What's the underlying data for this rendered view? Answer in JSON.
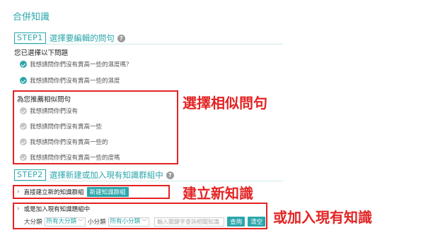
{
  "page_title": "合併知識",
  "step1": {
    "tag": "STEP1",
    "title": "選擇要編輯的問句",
    "selected_label": "您已選擇以下問題",
    "selected_questions": [
      "我想請問你們沒有賣高一些的濕度嗎？",
      "我想請問你們沒有賣高一些的濕度"
    ],
    "recommend_label": "為您推薦相似問句",
    "recommended_questions": [
      "我想請問你們沒有",
      "我想請問你們沒有賣高一些",
      "我想請問你們沒有賣高一些的",
      "我想請問你們沒有賣高一些的度嗎"
    ]
  },
  "step2": {
    "tag": "STEP2",
    "title": "選擇新建或加入現有知識群組中",
    "create_label": "直接建立新的知識群組",
    "create_button": "新建知識群組",
    "join_label": "或是加入現有知識題組中",
    "category_label": "大分類",
    "category_value": "所有大分類",
    "subcategory_label": "小分類",
    "subcategory_value": "所有小分類",
    "search_placeholder": "輸入關鍵字查詢相關知識",
    "search_button": "查詢",
    "clear_button": "清空"
  },
  "annotations": {
    "similar": "選擇相似問句",
    "create_new": "建立新知識",
    "join_existing": "或加入現有知識"
  },
  "colors": {
    "accent": "#2aa6ab",
    "annotation": "#e32323"
  }
}
